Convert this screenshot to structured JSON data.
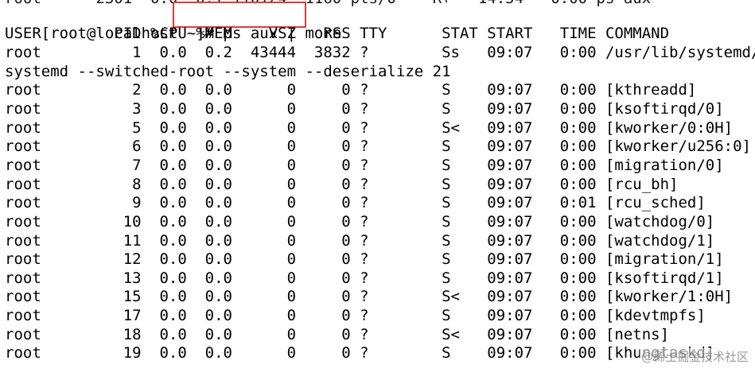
{
  "terminal": {
    "clipped_line": "root      2301  0.0  0.1 110124  1160 pts/0    R+   14:54   0:00 ps aux",
    "prompt": "[root@localhost ~]# ",
    "command": "ps aux | more",
    "header": "USER        PID %CPU %MEM    VSZ   RSS TTY      STAT START   TIME COMMAND",
    "rows": [
      "root          1  0.0  0.2  43444  3832 ?        Ss   09:07   0:00 /usr/lib/systemd/",
      "systemd --switched-root --system --deserialize 21",
      "root          2  0.0  0.0      0     0 ?        S    09:07   0:00 [kthreadd]",
      "root          3  0.0  0.0      0     0 ?        S    09:07   0:00 [ksoftirqd/0]",
      "root          5  0.0  0.0      0     0 ?        S<   09:07   0:00 [kworker/0:0H]",
      "root          6  0.0  0.0      0     0 ?        S    09:07   0:00 [kworker/u256:0]",
      "root          7  0.0  0.0      0     0 ?        S    09:07   0:00 [migration/0]",
      "root          8  0.0  0.0      0     0 ?        S    09:07   0:00 [rcu_bh]",
      "root          9  0.0  0.0      0     0 ?        S    09:07   0:01 [rcu_sched]",
      "root         10  0.0  0.0      0     0 ?        S    09:07   0:00 [watchdog/0]",
      "root         11  0.0  0.0      0     0 ?        S    09:07   0:00 [watchdog/1]",
      "root         12  0.0  0.0      0     0 ?        S    09:07   0:00 [migration/1]",
      "root         13  0.0  0.0      0     0 ?        S    09:07   0:00 [ksoftirqd/1]",
      "root         15  0.0  0.0      0     0 ?        S<   09:07   0:00 [kworker/1:0H]",
      "root         17  0.0  0.0      0     0 ?        S    09:07   0:00 [kdevtmpfs]",
      "root         18  0.0  0.0      0     0 ?        S<   09:07   0:00 [netns]",
      "root         19  0.0  0.0      0     0 ?        S    09:07   0:00 [khungtaskd]"
    ]
  },
  "highlight": {
    "color": "#e53935"
  },
  "watermark": "@稀土掘金技术社区"
}
